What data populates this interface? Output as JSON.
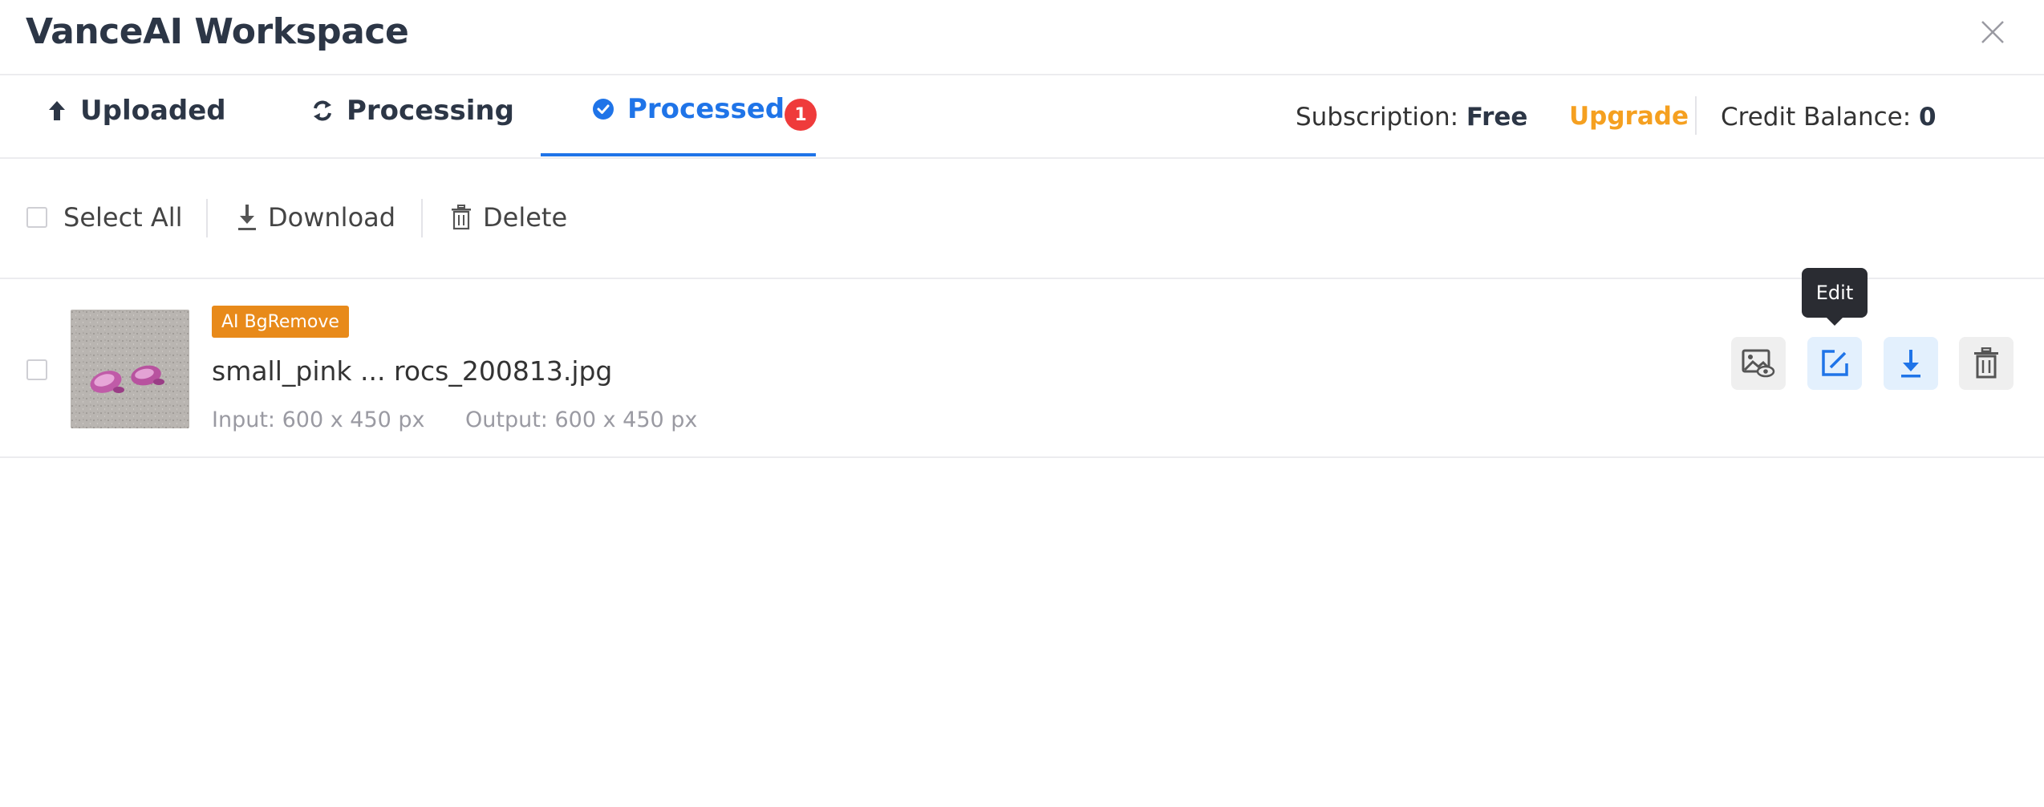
{
  "header": {
    "title": "VanceAI Workspace"
  },
  "tabs": [
    {
      "label": "Uploaded"
    },
    {
      "label": "Processing"
    },
    {
      "label": "Processed",
      "badge": "1",
      "active": true
    }
  ],
  "subscription": {
    "label": "Subscription:",
    "plan": "Free",
    "upgrade_label": "Upgrade"
  },
  "credits": {
    "label": "Credit Balance:",
    "value": "0"
  },
  "toolbar": {
    "select_all_label": "Select All",
    "download_label": "Download",
    "delete_label": "Delete"
  },
  "items": [
    {
      "tag": "AI BgRemove",
      "filename": "small_pink ... rocs_200813.jpg",
      "input": "Input: 600 x 450 px",
      "output": "Output: 600 x 450 px"
    }
  ],
  "tooltip": {
    "text": "Edit"
  },
  "icons": {
    "close": "close-icon",
    "uploaded": "upload-arrow-icon",
    "processing": "refresh-icon",
    "processed": "check-circle-icon",
    "download": "download-icon",
    "delete": "trash-icon",
    "preview": "image-preview-icon",
    "edit": "edit-icon"
  },
  "colors": {
    "accent": "#1f74e8",
    "badge": "#ef3b3b",
    "upgrade": "#f5a020",
    "tag": "#e88a1a"
  }
}
